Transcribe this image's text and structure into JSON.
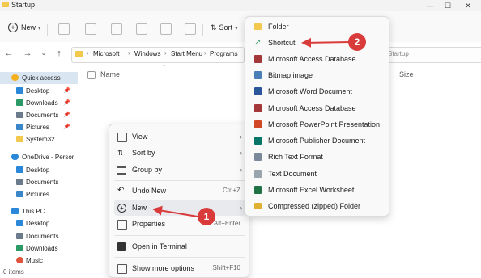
{
  "window": {
    "title": "Startup",
    "minimize": "—",
    "maximize": "☐",
    "close": "✕"
  },
  "toolbar": {
    "new_label": "New",
    "sort_label": "Sort"
  },
  "address": {
    "crumbs": [
      "Microsoft",
      "Windows",
      "Start Menu",
      "Programs"
    ],
    "search_placeholder": "Startup"
  },
  "sidebar": {
    "items": [
      {
        "label": "Quick access",
        "icon": "star-icon",
        "color": "#f2b01e"
      },
      {
        "label": "Desktop",
        "icon": "desktop-icon",
        "color": "#2b88d8"
      },
      {
        "label": "Downloads",
        "icon": "downloads-icon",
        "color": "#2b9a66"
      },
      {
        "label": "Documents",
        "icon": "documents-icon",
        "color": "#6b7b8c"
      },
      {
        "label": "Pictures",
        "icon": "pictures-icon",
        "color": "#3a86c8"
      },
      {
        "label": "System32",
        "icon": "folder-icon",
        "color": "#f2c94c"
      },
      {
        "label": "OneDrive - Persor",
        "icon": "cloud-icon",
        "color": "#2b88d8"
      },
      {
        "label": "Desktop",
        "icon": "desktop-icon",
        "color": "#2b88d8"
      },
      {
        "label": "Documents",
        "icon": "documents-icon",
        "color": "#6b7b8c"
      },
      {
        "label": "Pictures",
        "icon": "pictures-icon",
        "color": "#3a86c8"
      },
      {
        "label": "This PC",
        "icon": "pc-icon",
        "color": "#2b88d8"
      },
      {
        "label": "Desktop",
        "icon": "desktop-icon",
        "color": "#2b88d8"
      },
      {
        "label": "Documents",
        "icon": "documents-icon",
        "color": "#6b7b8c"
      },
      {
        "label": "Downloads",
        "icon": "downloads-icon",
        "color": "#2b9a66"
      },
      {
        "label": "Music",
        "icon": "music-icon",
        "color": "#e0533d"
      }
    ]
  },
  "columns": {
    "name": "Name",
    "size": "Size"
  },
  "status": {
    "items": "0 items"
  },
  "context_menu": {
    "items": [
      {
        "label": "View",
        "submenu": true
      },
      {
        "label": "Sort by",
        "submenu": true
      },
      {
        "label": "Group by",
        "submenu": true
      },
      {
        "label": "Undo New",
        "shortcut": "Ctrl+Z"
      },
      {
        "label": "New",
        "submenu": true
      },
      {
        "label": "Properties",
        "shortcut": "Alt+Enter"
      },
      {
        "label": "Open in Terminal"
      },
      {
        "label": "Show more options",
        "shortcut": "Shift+F10"
      }
    ]
  },
  "new_submenu": {
    "items": [
      {
        "label": "Folder",
        "icon": "folder-icon",
        "color": "#f2c94c"
      },
      {
        "label": "Shortcut",
        "icon": "shortcut-icon",
        "color": "#3a9a6a"
      },
      {
        "label": "Microsoft Access Database",
        "icon": "access-icon",
        "color": "#a4373a"
      },
      {
        "label": "Bitmap image",
        "icon": "bitmap-icon",
        "color": "#4a7fb5"
      },
      {
        "label": "Microsoft Word Document",
        "icon": "word-icon",
        "color": "#2b579a"
      },
      {
        "label": "Microsoft Access Database",
        "icon": "access-icon",
        "color": "#a4373a"
      },
      {
        "label": "Microsoft PowerPoint Presentation",
        "icon": "powerpoint-icon",
        "color": "#d24726"
      },
      {
        "label": "Microsoft Publisher Document",
        "icon": "publisher-icon",
        "color": "#077568"
      },
      {
        "label": "Rich Text Format",
        "icon": "rtf-icon",
        "color": "#7a8a9a"
      },
      {
        "label": "Text Document",
        "icon": "text-icon",
        "color": "#9aa4ae"
      },
      {
        "label": "Microsoft Excel Worksheet",
        "icon": "excel-icon",
        "color": "#217346"
      },
      {
        "label": "Compressed (zipped) Folder",
        "icon": "zip-icon",
        "color": "#e0b030"
      }
    ]
  },
  "annotations": {
    "step1": "1",
    "step2": "2",
    "color": "#d93b3b"
  }
}
